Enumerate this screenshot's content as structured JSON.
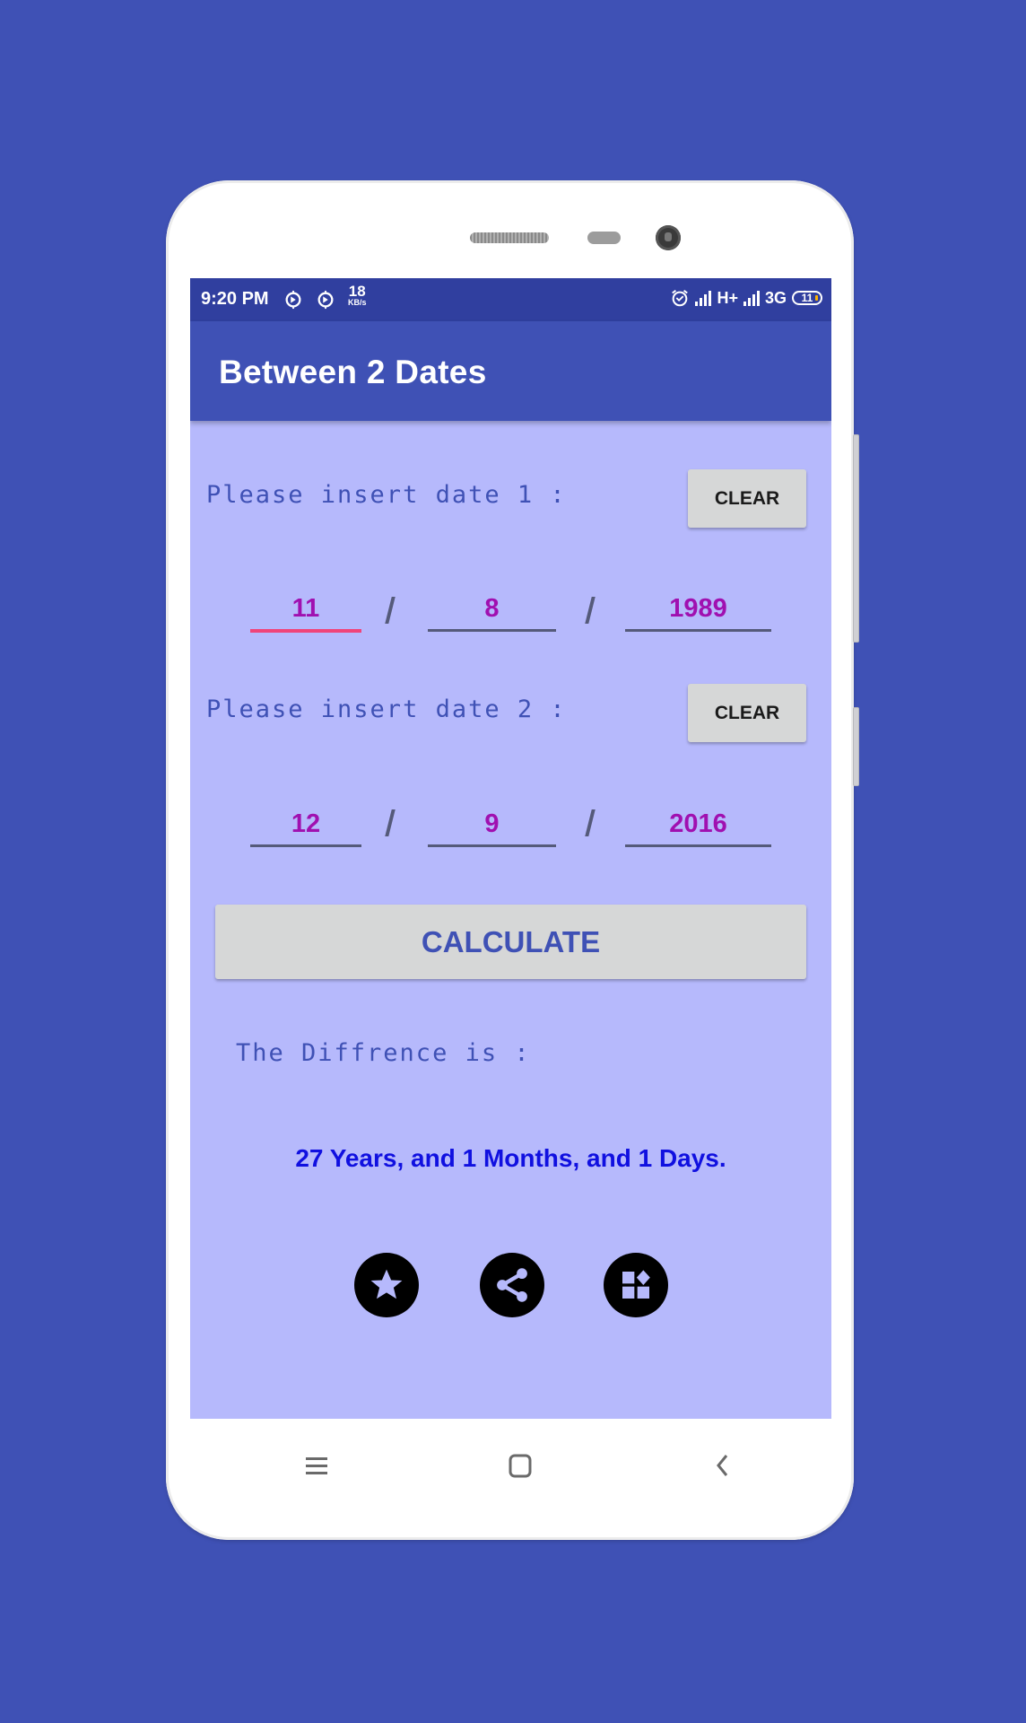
{
  "status_bar": {
    "time": "9:20 PM",
    "net_speed_value": "18",
    "net_speed_unit": "KB/s",
    "network_1": "H+",
    "network_2": "3G",
    "battery": "11",
    "icons": [
      "sync-icon",
      "sync-icon",
      "alarm-icon",
      "signal-icon",
      "signal-icon",
      "battery-icon"
    ]
  },
  "app": {
    "title": "Between 2 Dates",
    "colors": {
      "primary": "#3f51b5",
      "primary_dark": "#303f9f",
      "background": "#b6b9fc",
      "input_text": "#a010b0",
      "result_text": "#1010e0",
      "focus_accent": "#f0447a"
    }
  },
  "date1": {
    "label": "Please insert date 1 :",
    "clear_label": "CLEAR",
    "day": "11",
    "month": "8",
    "year": "1989",
    "separator": "/"
  },
  "date2": {
    "label": "Please insert date 2 :",
    "clear_label": "CLEAR",
    "day": "12",
    "month": "9",
    "year": "2016",
    "separator": "/"
  },
  "calculate_label": "CALCULATE",
  "difference_label": "The Diffrence is :",
  "result": "27 Years, and 1 Months, and 1 Days.",
  "actions": [
    "star-icon",
    "share-icon",
    "more-apps-icon"
  ],
  "nav": [
    "menu-icon",
    "home-icon",
    "back-icon"
  ]
}
